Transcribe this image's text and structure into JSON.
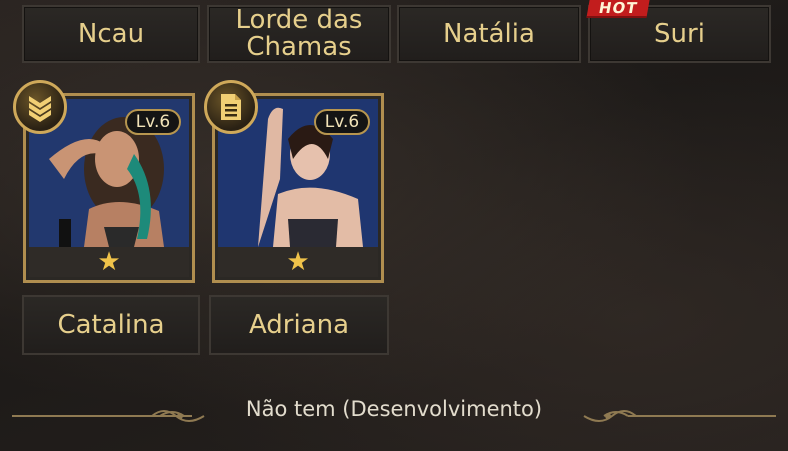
{
  "tabs": [
    {
      "label": "Ncau"
    },
    {
      "label": "Lorde das Chamas"
    },
    {
      "label": "Natália"
    },
    {
      "label": "Suri"
    }
  ],
  "hot_badge": "HOT",
  "cards": [
    {
      "name": "Catalina",
      "level": "Lv.6",
      "stars": 1,
      "icon": "chevrons-rank-icon"
    },
    {
      "name": "Adriana",
      "level": "Lv.6",
      "stars": 1,
      "icon": "document-icon"
    }
  ],
  "footer": {
    "text": "Não tem (Desenvolvimento)"
  },
  "colors": {
    "gold": "#e6cf8c",
    "border": "#b08e4f",
    "hot": "#c21d1d"
  }
}
